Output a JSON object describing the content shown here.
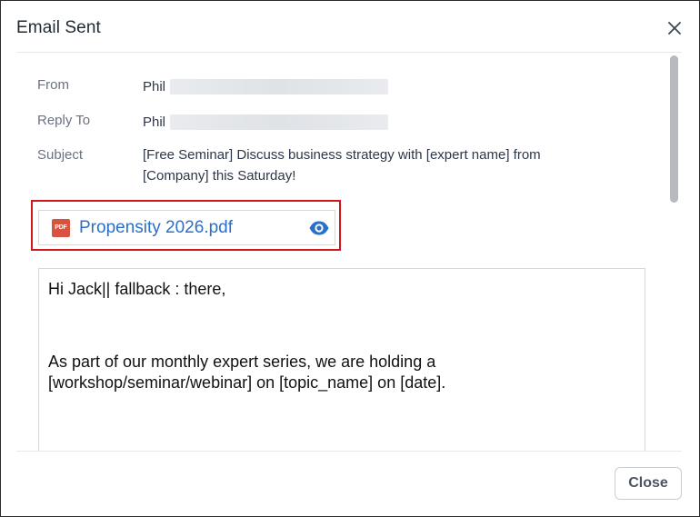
{
  "dialog": {
    "title": "Email Sent",
    "close_icon": "close-icon"
  },
  "fields": {
    "from": {
      "label": "From",
      "value": "Phil"
    },
    "reply_to": {
      "label": "Reply To",
      "value": "Phil"
    },
    "subject": {
      "label": "Subject",
      "line1": "[Free Seminar] Discuss business strategy with [expert name] from",
      "line2": "[Company] this Saturday!"
    }
  },
  "attachment": {
    "file_name": "Propensity 2026.pdf",
    "file_icon": "pdf-icon",
    "file_icon_text": "PDF",
    "preview_icon": "eye-icon",
    "highlight_color": "#d0161b"
  },
  "email_body": {
    "lines": [
      "Hi Jack|| fallback : there,",
      "As part of our monthly expert series, we are holding a",
      "[workshop/seminar/webinar] on [topic_name] on [date]."
    ]
  },
  "footer": {
    "close_label": "Close"
  },
  "colors": {
    "link": "#2a6fc9",
    "pdf": "#d8533f",
    "label": "#6b7280"
  }
}
